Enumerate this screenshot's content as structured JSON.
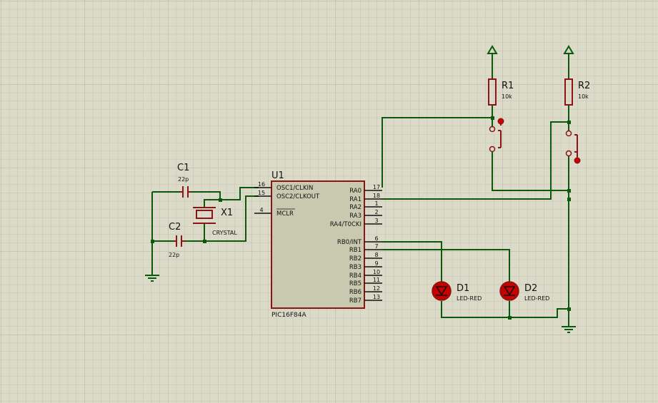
{
  "colors": {
    "background": "#dcdbc9",
    "wire": "#0b5a0b",
    "component": "#8b1414",
    "chip_fill": "#c9c9b0",
    "led_fill": "#c40000"
  },
  "u1": {
    "ref": "U1",
    "part": "PIC16F84A",
    "left_pins": [
      {
        "num": "16",
        "name": "OSC1/CLKIN"
      },
      {
        "num": "15",
        "name": "OSC2/CLKOUT"
      },
      {
        "num": "4",
        "name": "MCLR"
      }
    ],
    "right_pins": [
      {
        "num": "17",
        "name": "RA0"
      },
      {
        "num": "18",
        "name": "RA1"
      },
      {
        "num": "1",
        "name": "RA2"
      },
      {
        "num": "2",
        "name": "RA3"
      },
      {
        "num": "3",
        "name": "RA4/T0CKI"
      },
      {
        "num": "6",
        "name": "RB0/INT"
      },
      {
        "num": "7",
        "name": "RB1"
      },
      {
        "num": "8",
        "name": "RB2"
      },
      {
        "num": "9",
        "name": "RB3"
      },
      {
        "num": "10",
        "name": "RB4"
      },
      {
        "num": "11",
        "name": "RB5"
      },
      {
        "num": "12",
        "name": "RB6"
      },
      {
        "num": "13",
        "name": "RB7"
      }
    ]
  },
  "c1": {
    "ref": "C1",
    "value": "22p"
  },
  "c2": {
    "ref": "C2",
    "value": "22p"
  },
  "x1": {
    "ref": "X1",
    "value": "CRYSTAL"
  },
  "r1": {
    "ref": "R1",
    "value": "10k"
  },
  "r2": {
    "ref": "R2",
    "value": "10k"
  },
  "d1": {
    "ref": "D1",
    "value": "LED-RED"
  },
  "d2": {
    "ref": "D2",
    "value": "LED-RED"
  }
}
